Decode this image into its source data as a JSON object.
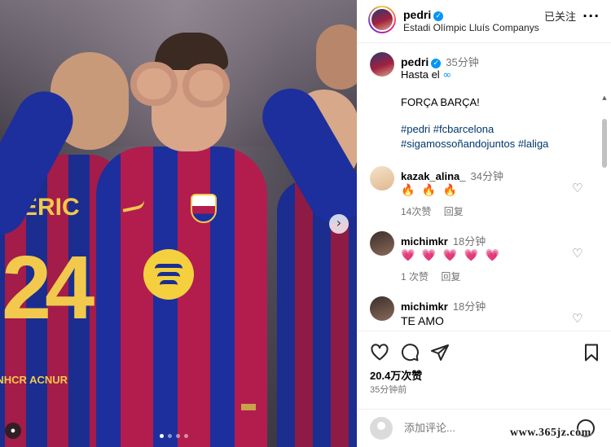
{
  "post": {
    "username": "pedri",
    "location": "Estadi Olímpic Lluís Companys",
    "follow_status": "已关注",
    "more": "···"
  },
  "caption": {
    "username": "pedri",
    "time": "35分钟",
    "line1": "Hasta el",
    "line2": "FORÇA BARÇA!",
    "hashtags_line1": "#pedri #fcbarcelona",
    "hashtags_line2": "#sigamossoñandojuntos #laliga"
  },
  "comments": [
    {
      "username": "kazak_alina_",
      "time": "34分钟",
      "text": "🔥 🔥 🔥",
      "likes": "14次赞",
      "reply": "回复"
    },
    {
      "username": "michimkr",
      "time": "18分钟",
      "text": "💗 💗 💗 💗 💗",
      "likes": "1 次赞",
      "reply": "回复"
    },
    {
      "username": "michimkr",
      "time": "18分钟",
      "text": "TE AMO",
      "likes": "",
      "reply": ""
    }
  ],
  "likes_count": "20.4万次赞",
  "posted_time": "35分钟前",
  "comment_placeholder": "添加评论...",
  "photo": {
    "jersey_name": "ERIC",
    "jersey_number": "24",
    "sponsor": "UNHCR ACNUR",
    "carousel_dots": 4,
    "active_dot": 0
  },
  "watermark": "www.365jz.com",
  "icons": {
    "like": "heart-icon",
    "comment": "comment-icon",
    "share": "share-icon",
    "save": "bookmark-icon",
    "emoji": "emoji-icon"
  },
  "colors": {
    "verified": "#0095f6",
    "hashtag": "#00376b",
    "muted": "#737373"
  }
}
